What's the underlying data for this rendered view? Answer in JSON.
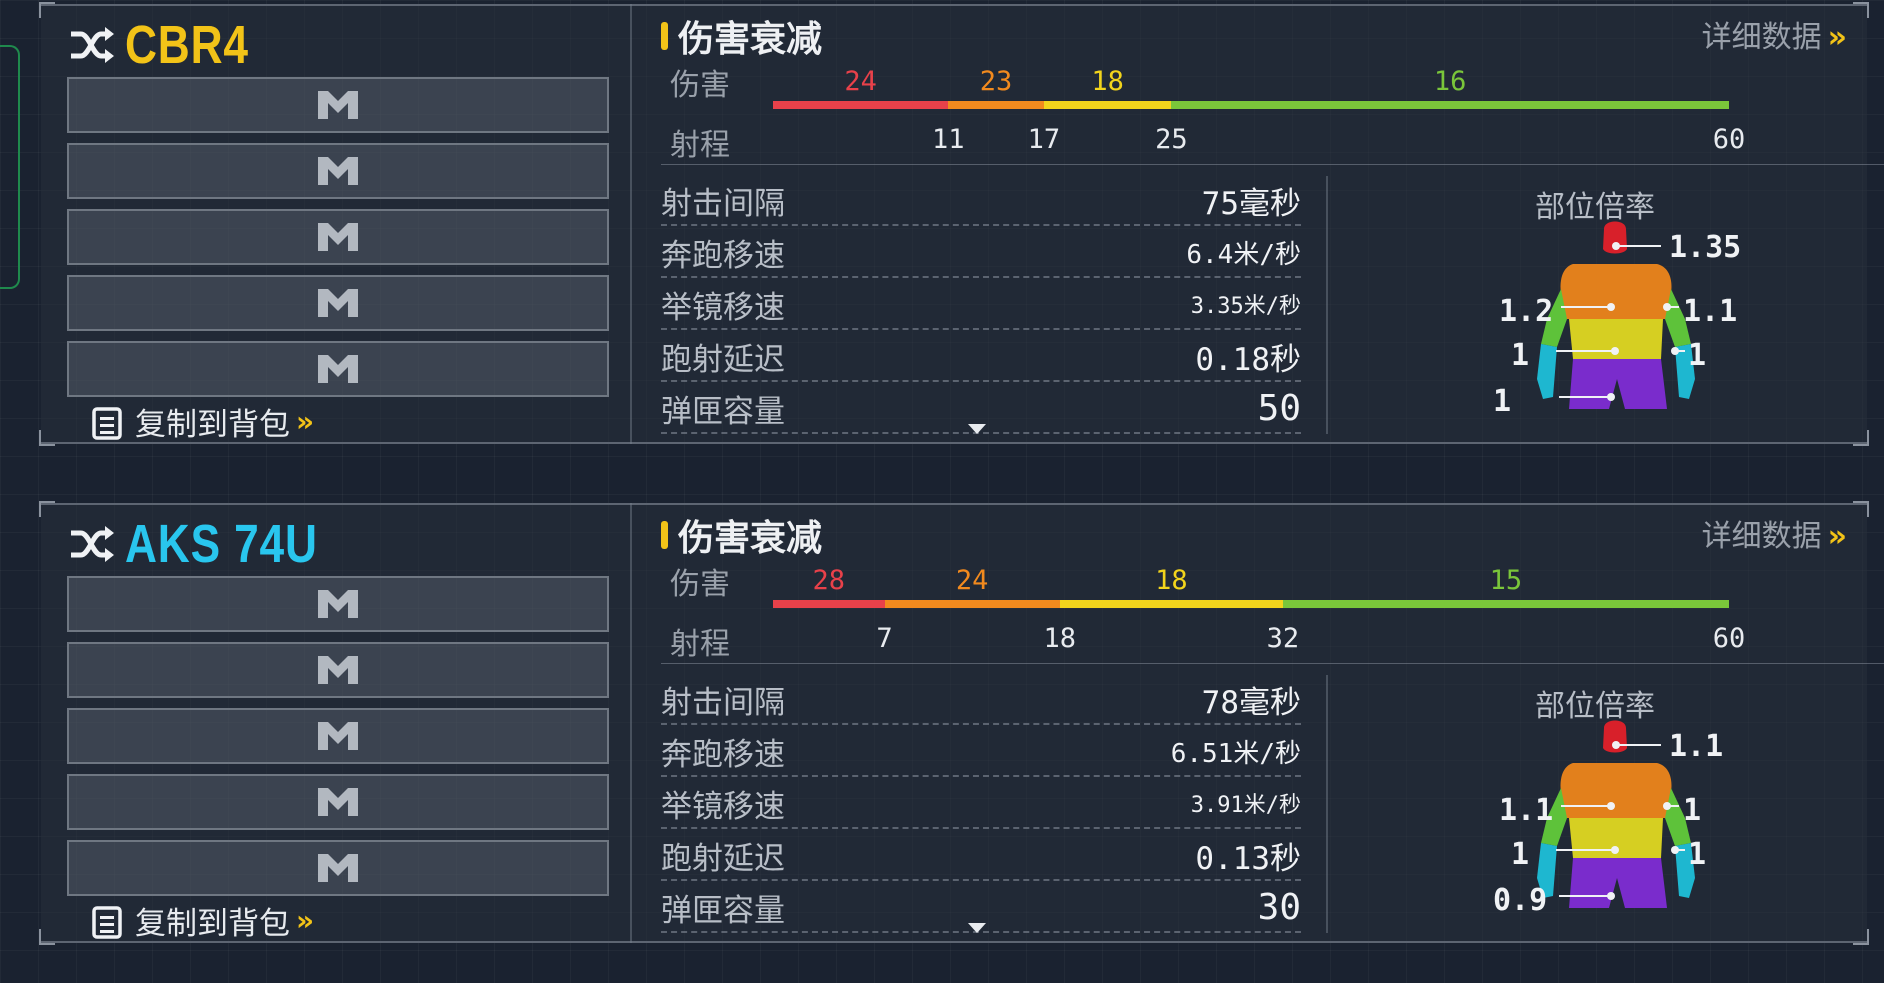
{
  "panels": [
    {
      "weapon_name": "CBR4",
      "name_color": "#f2c318",
      "copy_label": "复制到背包",
      "damage_falloff": {
        "title": "伤害衰减",
        "detail_link": "详细数据",
        "damage_label": "伤害",
        "range_label": "射程",
        "damages": [
          "24",
          "23",
          "18",
          "16"
        ],
        "ranges": [
          "11",
          "17",
          "25",
          "60"
        ]
      },
      "stats": [
        {
          "label": "射击间隔",
          "value": "75毫秒"
        },
        {
          "label": "奔跑移速",
          "value": "6.4米/秒"
        },
        {
          "label": "举镜移速",
          "value": "3.35米/秒"
        },
        {
          "label": "跑射延迟",
          "value": "0.18秒"
        },
        {
          "label": "弹匣容量",
          "value": "50"
        }
      ],
      "body_multiplier": {
        "title": "部位倍率",
        "head": "1.35",
        "chest": "1.2",
        "upper_arm": "1.1",
        "stomach": "1",
        "forearm": "1",
        "legs": "1"
      }
    },
    {
      "weapon_name": "AKS 74U",
      "name_color": "#29c6ee",
      "copy_label": "复制到背包",
      "damage_falloff": {
        "title": "伤害衰减",
        "detail_link": "详细数据",
        "damage_label": "伤害",
        "range_label": "射程",
        "damages": [
          "28",
          "24",
          "18",
          "15"
        ],
        "ranges": [
          "7",
          "18",
          "32",
          "60"
        ]
      },
      "stats": [
        {
          "label": "射击间隔",
          "value": "78毫秒"
        },
        {
          "label": "奔跑移速",
          "value": "6.51米/秒"
        },
        {
          "label": "举镜移速",
          "value": "3.91米/秒"
        },
        {
          "label": "跑射延迟",
          "value": "0.13秒"
        },
        {
          "label": "弹匣容量",
          "value": "30"
        }
      ],
      "body_multiplier": {
        "title": "部位倍率",
        "head": "1.1",
        "chest": "1.1",
        "upper_arm": "1",
        "stomach": "1",
        "forearm": "1",
        "legs": "0.9"
      }
    }
  ],
  "colors": {
    "seg1": "#e8414a",
    "seg2": "#f28a1e",
    "seg3": "#f2d41c",
    "seg4": "#7ac63a",
    "accent": "#f2c318"
  },
  "icons": {
    "shuffle": "shuffle-icon",
    "slot": "attachment-slot-icon",
    "copy": "clipboard-icon",
    "chevron": "double-chevron-icon"
  }
}
